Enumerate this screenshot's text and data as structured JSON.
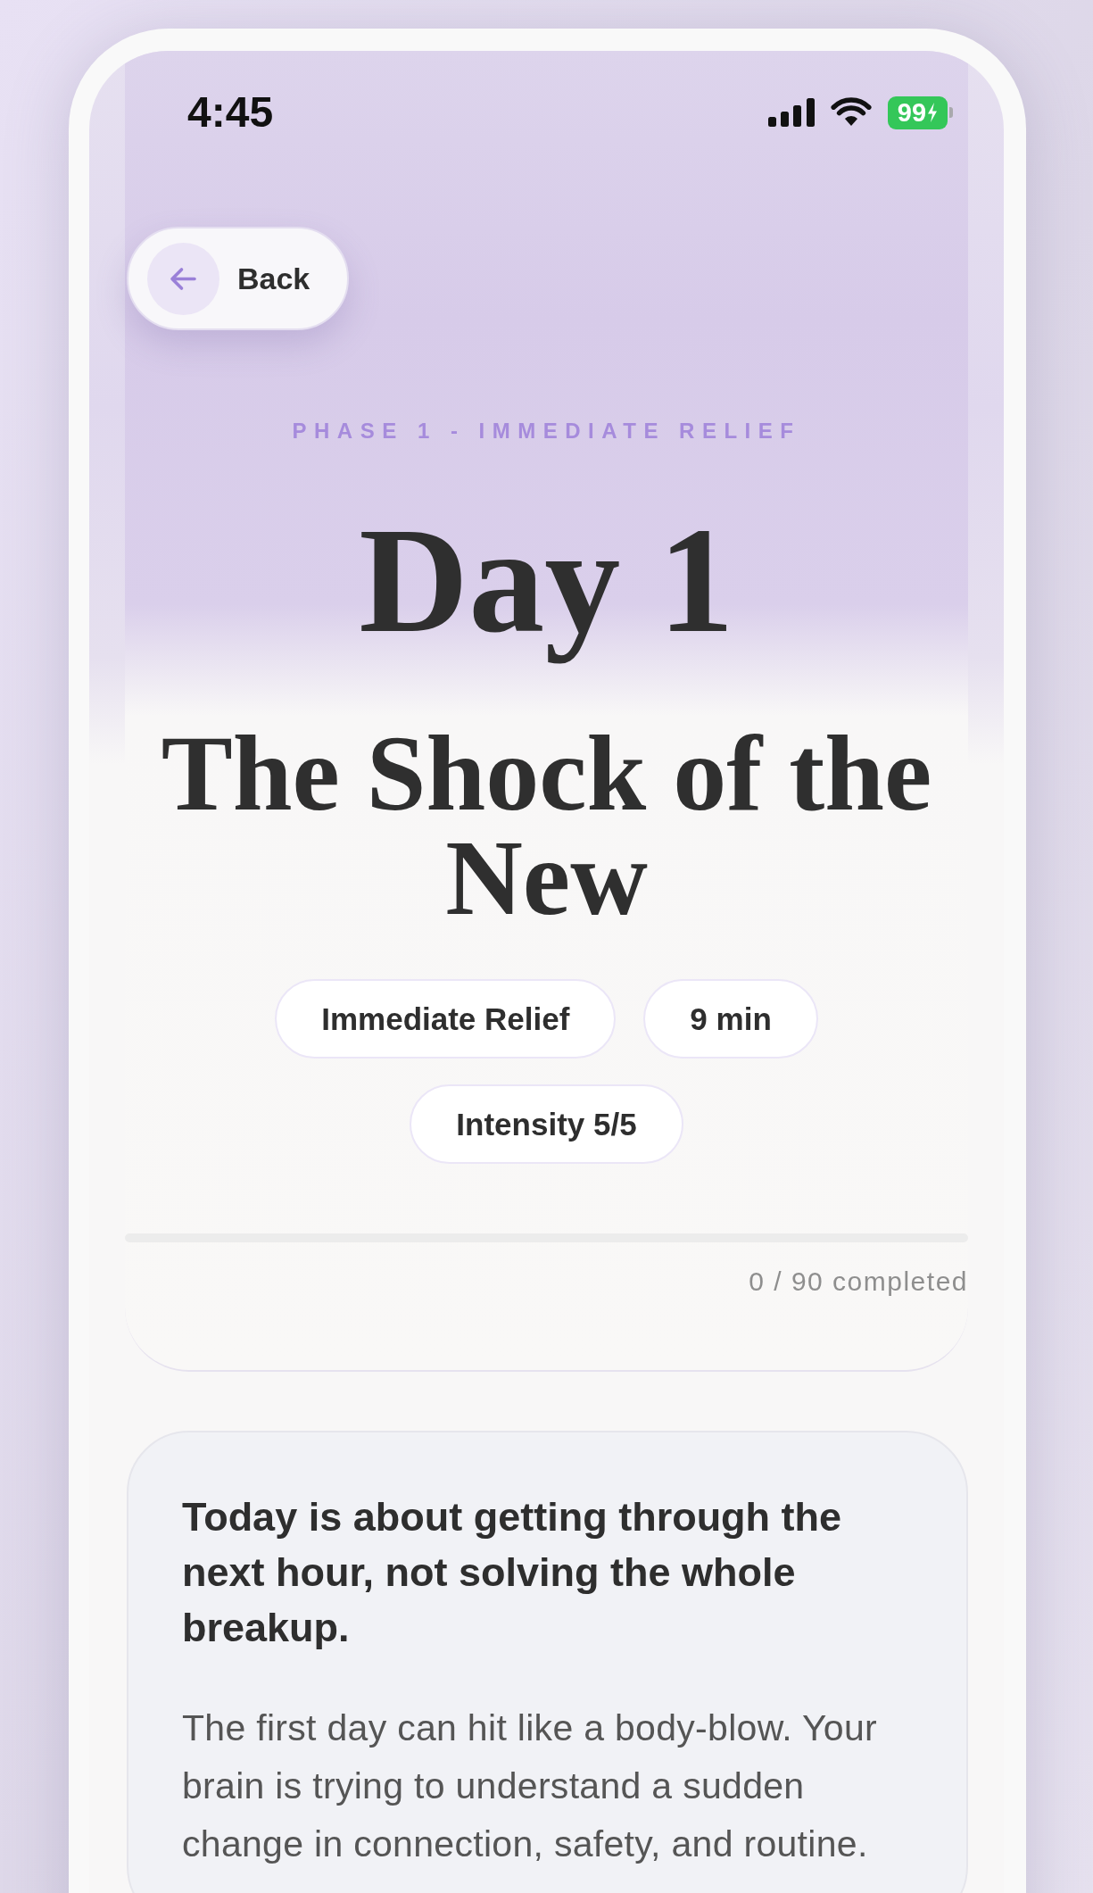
{
  "status_bar": {
    "time": "4:45",
    "battery": "99"
  },
  "back_button": {
    "label": "Back"
  },
  "phase_label": "PHASE 1 - IMMEDIATE RELIEF",
  "day_heading": "Day 1",
  "title": "The Shock of the New",
  "tags": [
    "Immediate Relief",
    "9 min",
    "Intensity 5/5"
  ],
  "progress": {
    "level": 0,
    "caption": "0 / 90 completed"
  },
  "intro_card": {
    "heading": "Today is about getting through the next hour, not solving the whole breakup.",
    "body": "The first day can hit like a body-blow. Your brain is trying to understand a sudden change in connection, safety, and routine."
  }
}
